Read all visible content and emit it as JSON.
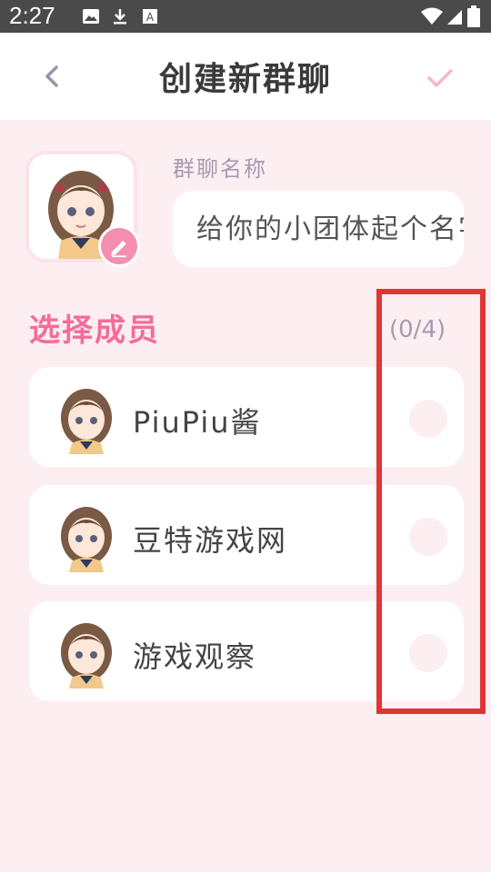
{
  "status_bar": {
    "time": "2:27",
    "icons": [
      "image-icon",
      "download-icon",
      "a-badge-icon",
      "wifi-icon",
      "signal-icon",
      "battery-icon"
    ]
  },
  "header": {
    "title": "创建新群聊",
    "back_icon": "chevron-left-icon",
    "confirm_icon": "check-icon"
  },
  "group": {
    "name_label": "群聊名称",
    "name_placeholder": "给你的小团体起个名字吧",
    "edit_icon": "pencil-icon"
  },
  "members_section": {
    "title": "选择成员",
    "count": "(0/4)",
    "members": [
      {
        "name": "PiuPiu酱",
        "selected": false
      },
      {
        "name": "豆特游戏网",
        "selected": false
      },
      {
        "name": "游戏观察",
        "selected": false
      }
    ]
  },
  "colors": {
    "accent": "#f46b9c",
    "background": "#fdeef2",
    "highlight": "#e03535"
  }
}
